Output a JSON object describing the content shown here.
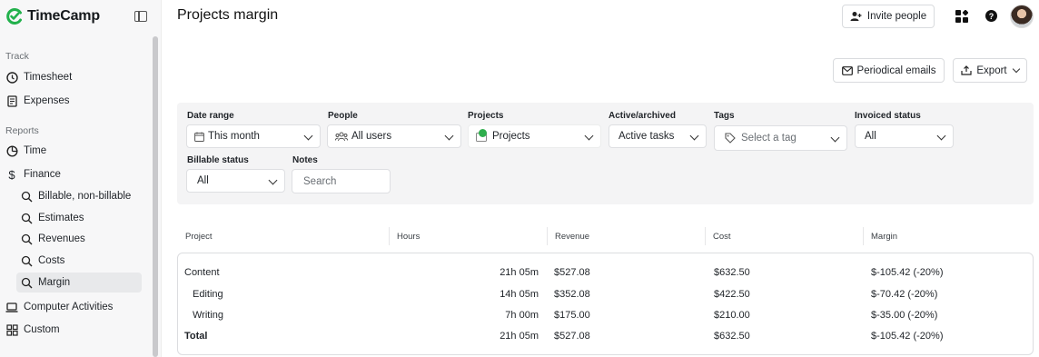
{
  "app": {
    "name": "TimeCamp",
    "page_title": "Projects margin"
  },
  "sidebar": {
    "track_label": "Track",
    "track_items": [
      {
        "label": "Timesheet",
        "icon": "clock-icon"
      },
      {
        "label": "Expenses",
        "icon": "receipt-icon"
      }
    ],
    "reports_label": "Reports",
    "reports_items": [
      {
        "label": "Time",
        "icon": "pie-icon"
      },
      {
        "label": "Finance",
        "icon": "dollar-icon"
      }
    ],
    "finance_sub": [
      {
        "label": "Billable, non-billable"
      },
      {
        "label": "Estimates"
      },
      {
        "label": "Revenues"
      },
      {
        "label": "Costs"
      },
      {
        "label": "Margin",
        "active": true
      }
    ],
    "other_items": [
      {
        "label": "Computer Activities",
        "icon": "laptop-icon"
      },
      {
        "label": "Custom",
        "icon": "grid-icon"
      }
    ]
  },
  "header": {
    "invite_label": "Invite people"
  },
  "actions": {
    "periodical_label": "Periodical emails",
    "export_label": "Export"
  },
  "filters": {
    "date_range": {
      "label": "Date range",
      "value": "This month"
    },
    "people": {
      "label": "People",
      "value": "All users"
    },
    "projects": {
      "label": "Projects",
      "value": "Projects"
    },
    "active_archived": {
      "label": "Active/archived",
      "value": "Active tasks"
    },
    "tags": {
      "label": "Tags",
      "placeholder": "Select a tag"
    },
    "invoiced": {
      "label": "Invoiced status",
      "value": "All"
    },
    "billable": {
      "label": "Billable status",
      "value": "All"
    },
    "notes": {
      "label": "Notes",
      "placeholder": "Search"
    }
  },
  "table": {
    "headers": [
      "Project",
      "Hours",
      "Revenue",
      "Cost",
      "Margin"
    ],
    "rows": [
      {
        "project": "Content",
        "hours": "21h 05m",
        "revenue": "$527.08",
        "cost": "$632.50",
        "margin": "$-105.42 (-20%)"
      },
      {
        "project": "Editing",
        "hours": "14h 05m",
        "revenue": "$352.08",
        "cost": "$422.50",
        "margin": "$-70.42 (-20%)"
      },
      {
        "project": "Writing",
        "hours": "7h 00m",
        "revenue": "$175.00",
        "cost": "$210.00",
        "margin": "$-35.00 (-20%)"
      },
      {
        "project": "Total",
        "hours": "21h 05m",
        "revenue": "$527.08",
        "cost": "$632.50",
        "margin": "$-105.42 (-20%)"
      }
    ]
  },
  "colors": {
    "brand": "#22b14c",
    "sidebar_bg": "#f7f7f8",
    "filter_bg": "#f4f4f5"
  }
}
